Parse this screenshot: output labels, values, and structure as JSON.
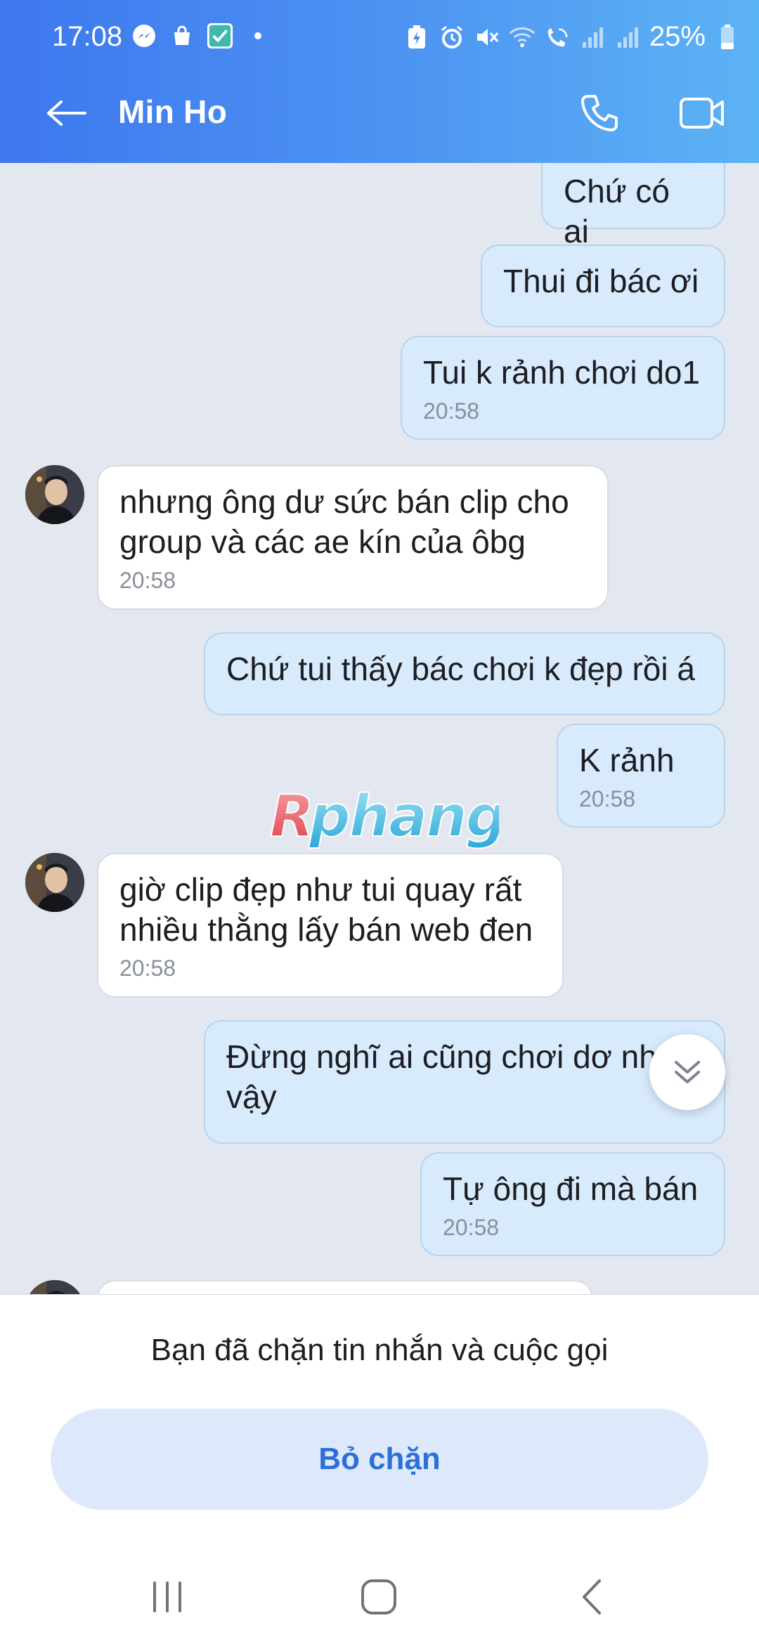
{
  "status_bar": {
    "time": "17:08",
    "battery_percent": "25%",
    "left_icons": [
      "messenger-icon",
      "shopping-bag-icon",
      "check-app-icon",
      "dot-icon"
    ],
    "right_icons": [
      "battery-saver-icon",
      "alarm-icon",
      "mute-icon",
      "wifi-icon",
      "wifi-calling-icon",
      "signal-icon",
      "signal-icon",
      "battery-icon"
    ]
  },
  "header": {
    "contact_name": "Min Ho",
    "gradient_start": "#3d78ee",
    "gradient_end": "#5cb3f4"
  },
  "messages": [
    {
      "dir": "out",
      "text": "Chứ có ai",
      "time": ""
    },
    {
      "dir": "out",
      "text": "Thui đi bác ơi",
      "time": ""
    },
    {
      "dir": "out",
      "text": "Tui k rảnh chơi do1",
      "time": "20:58"
    },
    {
      "dir": "in",
      "line1": "nhưng ông dư sức bán clip cho",
      "line2": "group và các ae kín của ôbg",
      "time": "20:58"
    },
    {
      "dir": "out",
      "text": "Chứ tui thấy bác chơi k đẹp rồi á",
      "time": ""
    },
    {
      "dir": "out",
      "text": "K rảnh",
      "time": "20:58"
    },
    {
      "dir": "in",
      "line1": "giờ clip đẹp như tui quay rất",
      "line2": "nhiều thằng lấy bán web đen",
      "time": "20:58"
    },
    {
      "dir": "out",
      "line1": "Đừng nghĩ ai cũng chơi dơ như",
      "line2": "vậy",
      "time": ""
    },
    {
      "dir": "out",
      "text": "Tự ông đi mà bán",
      "time": "20:58"
    }
  ],
  "watermark": "Rphang",
  "blocked": {
    "notice": "Bạn đã chặn tin nhắn và cuộc gọi",
    "unblock_label": "Bỏ chặn"
  },
  "colors": {
    "outgoing_bubble": "#d8ebfc",
    "incoming_bubble": "#ffffff",
    "chat_background": "#e3e7ef",
    "accent": "#2d6fd9"
  }
}
